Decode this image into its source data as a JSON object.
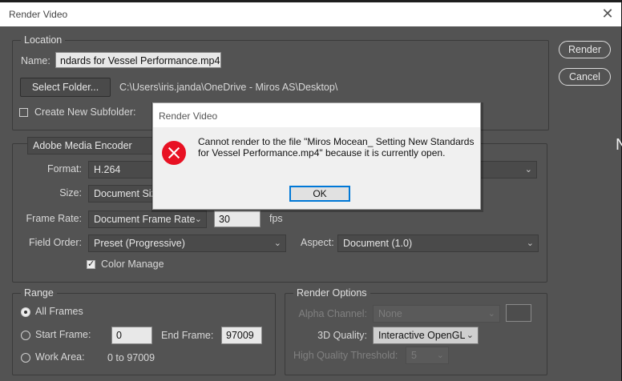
{
  "dialog": {
    "title": "Render Video",
    "close_glyph": "✕",
    "render_button": "Render",
    "cancel_button": "Cancel"
  },
  "location": {
    "legend": "Location",
    "name_label": "Name:",
    "name_value": "ndards for Vessel Performance.mp4",
    "select_folder_button": "Select Folder...",
    "folder_path": "C:\\Users\\iris.janda\\OneDrive - Miros AS\\Desktop\\",
    "subfolder_label": "Create New Subfolder:",
    "subfolder_checked": false
  },
  "encoder": {
    "engine": "Adobe Media Encoder",
    "format_label": "Format:",
    "format_value": "H.264",
    "size_label": "Size:",
    "size_value": "Document Siz",
    "frame_rate_label": "Frame Rate:",
    "frame_rate_value": "Document Frame Rate",
    "fps_value": "30",
    "fps_unit": "fps",
    "field_order_label": "Field Order:",
    "field_order_value": "Preset (Progressive)",
    "aspect_label": "Aspect:",
    "aspect_value": "Document (1.0)",
    "color_manage_label": "Color Manage",
    "color_manage_checked": true
  },
  "range": {
    "legend": "Range",
    "all_frames": "All Frames",
    "start_frame_label": "Start Frame:",
    "start_frame_value": "0",
    "end_frame_label": "End Frame:",
    "end_frame_value": "97009",
    "work_area_label": "Work Area:",
    "work_area_value": "0 to 97009",
    "selected": "all_frames"
  },
  "render_options": {
    "legend": "Render Options",
    "alpha_label": "Alpha Channel:",
    "alpha_value": "None",
    "quality_label": "3D Quality:",
    "quality_value": "Interactive OpenGL",
    "hq_label": "High Quality Threshold:",
    "hq_value": "5"
  },
  "error_modal": {
    "title": "Render Video",
    "message": "Cannot render to the file \"Miros Mocean_ Setting New Standards for Vessel Performance.mp4\" because it is currently open.",
    "ok_button": "OK",
    "icon": "error-icon"
  },
  "background": {
    "letter": "N"
  },
  "colors": {
    "dialog_bg": "#535353",
    "error_red": "#e81123",
    "focus_blue": "#0078d7"
  }
}
